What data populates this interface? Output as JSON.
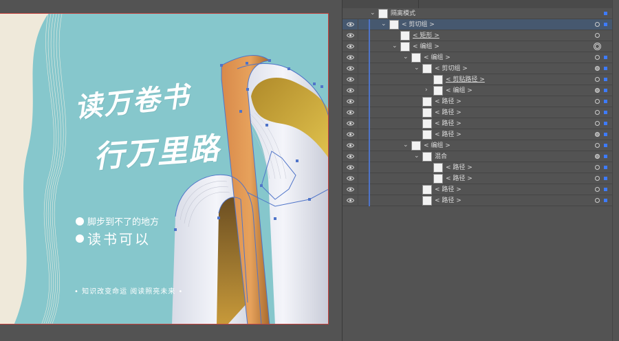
{
  "artboard": {
    "title_line1": "读万卷书",
    "title_line2": "行万里路",
    "bullet1": "脚步到不了的地方",
    "bullet2": "读书可以",
    "slogan": "• 知识改变命运   阅读照亮未来 •"
  },
  "colors": {
    "artboard_bg": "#86c7cc",
    "selection_path": "#4f74c9",
    "book_orange": "#dc9552",
    "book_gold": "#c9a63c",
    "page_white": "#eef0f6",
    "panel_bg": "#535353",
    "selected_row": "#46586f"
  },
  "layers": [
    {
      "label": "隔离模式",
      "icon": "isolation-mode-icon",
      "expanded": true,
      "indent": 0
    },
    {
      "label": "< 剪切组 >",
      "icon": "clip-group-icon",
      "expanded": true,
      "indent": 1,
      "selected": true
    },
    {
      "label": "< 矩形 >",
      "icon": "rectangle-icon",
      "indent": 2,
      "underline": true
    },
    {
      "label": "< 编组 >",
      "icon": "group-icon",
      "expanded": true,
      "indent": 2
    },
    {
      "label": "< 编组 >",
      "icon": "group-icon",
      "expanded": true,
      "indent": 3
    },
    {
      "label": "< 剪切组 >",
      "icon": "clip-group-icon",
      "expanded": true,
      "indent": 4
    },
    {
      "label": "< 剪贴路径 >",
      "icon": "clip-path-icon",
      "indent": 5,
      "underline": true
    },
    {
      "label": "< 编组 >",
      "icon": "group-icon",
      "collapsed": true,
      "indent": 5
    },
    {
      "label": "< 路径 >",
      "icon": "path-icon",
      "indent": 4
    },
    {
      "label": "< 路径 >",
      "icon": "path-icon",
      "indent": 4
    },
    {
      "label": "< 路径 >",
      "icon": "path-icon",
      "indent": 4
    },
    {
      "label": "< 路径 >",
      "icon": "path-icon",
      "indent": 4
    },
    {
      "label": "< 编组 >",
      "icon": "group-icon",
      "expanded": true,
      "indent": 3
    },
    {
      "label": "混合",
      "icon": "blend-icon",
      "expanded": true,
      "indent": 4
    },
    {
      "label": "< 路径 >",
      "icon": "path-icon",
      "indent": 5
    },
    {
      "label": "< 路径 >",
      "icon": "path-icon",
      "indent": 5
    },
    {
      "label": "< 路径 >",
      "icon": "path-icon",
      "indent": 4
    },
    {
      "label": "< 路径 >",
      "icon": "path-icon",
      "indent": 4
    }
  ]
}
